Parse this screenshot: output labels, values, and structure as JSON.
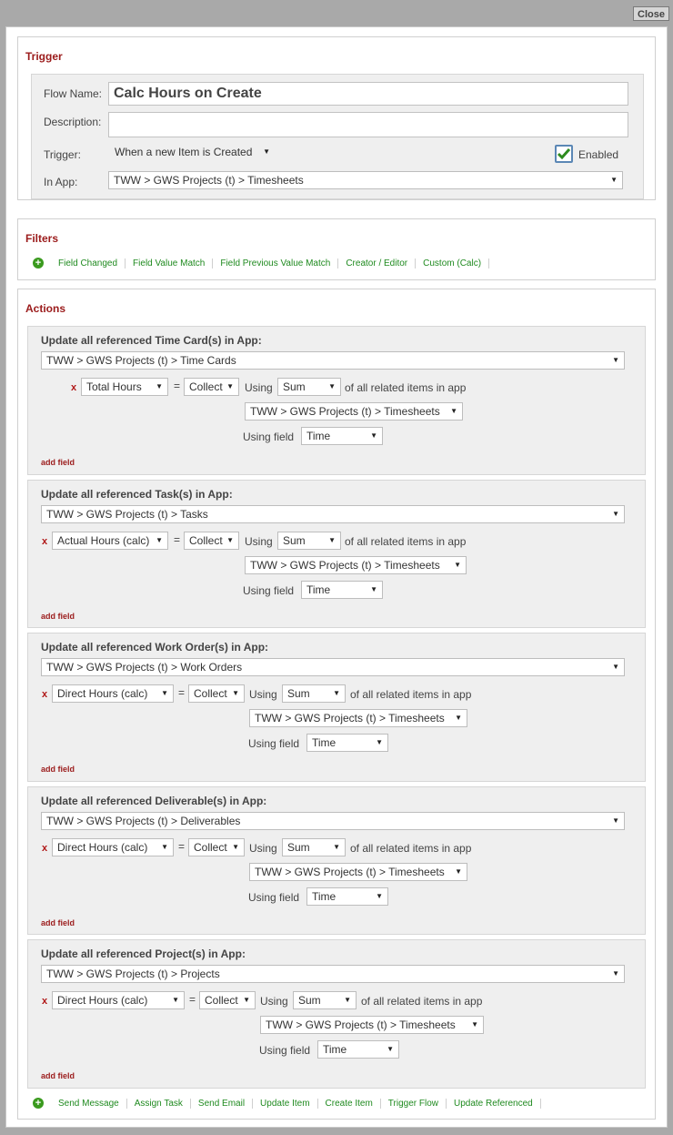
{
  "close_label": "Close",
  "trigger": {
    "title": "Trigger",
    "flow_name_label": "Flow Name:",
    "flow_name_value": "Calc Hours on Create",
    "description_label": "Description:",
    "description_value": "",
    "trigger_label": "Trigger:",
    "trigger_value": "When a new Item is Created",
    "enabled_label": "Enabled",
    "enabled": true,
    "in_app_label": "In App:",
    "in_app_value": "TWW > GWS Projects (t) > Timesheets"
  },
  "filters": {
    "title": "Filters",
    "links": [
      "Field Changed",
      "Field Value Match",
      "Field Previous Value Match",
      "Creator / Editor",
      "Custom (Calc)"
    ]
  },
  "actions": {
    "title": "Actions",
    "items": [
      {
        "title": "Update all referenced Time Card(s) in App:",
        "app": "TWW > GWS Projects (t) > Time Cards",
        "field": "Total Hours",
        "eq": "=",
        "op": "Collect",
        "using": "Using",
        "agg": "Sum",
        "of_all": "of all related items in app",
        "related_app": "TWW > GWS Projects (t) > Timesheets",
        "using_field_label": "Using field",
        "using_field": "Time",
        "add_field": "add field"
      },
      {
        "title": "Update all referenced Task(s) in App:",
        "app": "TWW > GWS Projects (t) > Tasks",
        "field": "Actual Hours (calc)",
        "eq": "=",
        "op": "Collect",
        "using": "Using",
        "agg": "Sum",
        "of_all": "of all related items in app",
        "related_app": "TWW > GWS Projects (t) > Timesheets",
        "using_field_label": "Using field",
        "using_field": "Time",
        "add_field": "add field"
      },
      {
        "title": "Update all referenced Work Order(s) in App:",
        "app": "TWW > GWS Projects (t) > Work Orders",
        "field": "Direct Hours (calc)",
        "eq": "=",
        "op": "Collect",
        "using": "Using",
        "agg": "Sum",
        "of_all": "of all related items in app",
        "related_app": "TWW > GWS Projects (t) > Timesheets",
        "using_field_label": "Using field",
        "using_field": "Time",
        "add_field": "add field"
      },
      {
        "title": "Update all referenced Deliverable(s) in App:",
        "app": "TWW > GWS Projects (t) > Deliverables",
        "field": "Direct Hours (calc)",
        "eq": "=",
        "op": "Collect",
        "using": "Using",
        "agg": "Sum",
        "of_all": "of all related items in app",
        "related_app": "TWW > GWS Projects (t) > Timesheets",
        "using_field_label": "Using field",
        "using_field": "Time",
        "add_field": "add field"
      },
      {
        "title": "Update all referenced Project(s) in App:",
        "app": "TWW > GWS Projects (t) > Projects",
        "field": "Direct Hours (calc)",
        "eq": "=",
        "op": "Collect",
        "using": "Using",
        "agg": "Sum",
        "of_all": "of all related items in app",
        "related_app": "TWW > GWS Projects (t) > Timesheets",
        "using_field_label": "Using field",
        "using_field": "Time",
        "add_field": "add field"
      }
    ],
    "links": [
      "Send Message",
      "Assign Task",
      "Send Email",
      "Update Item",
      "Create Item",
      "Trigger Flow",
      "Update Referenced"
    ]
  },
  "icons": {
    "add": "plus-circle-icon",
    "remove": "x-icon",
    "dropdown": "caret-down-icon",
    "check": "checkmark-icon"
  },
  "colors": {
    "section_title": "#9b1b1b",
    "link": "#1f8a1f",
    "add_icon": "#3a9a1e",
    "remove": "#b01818"
  }
}
